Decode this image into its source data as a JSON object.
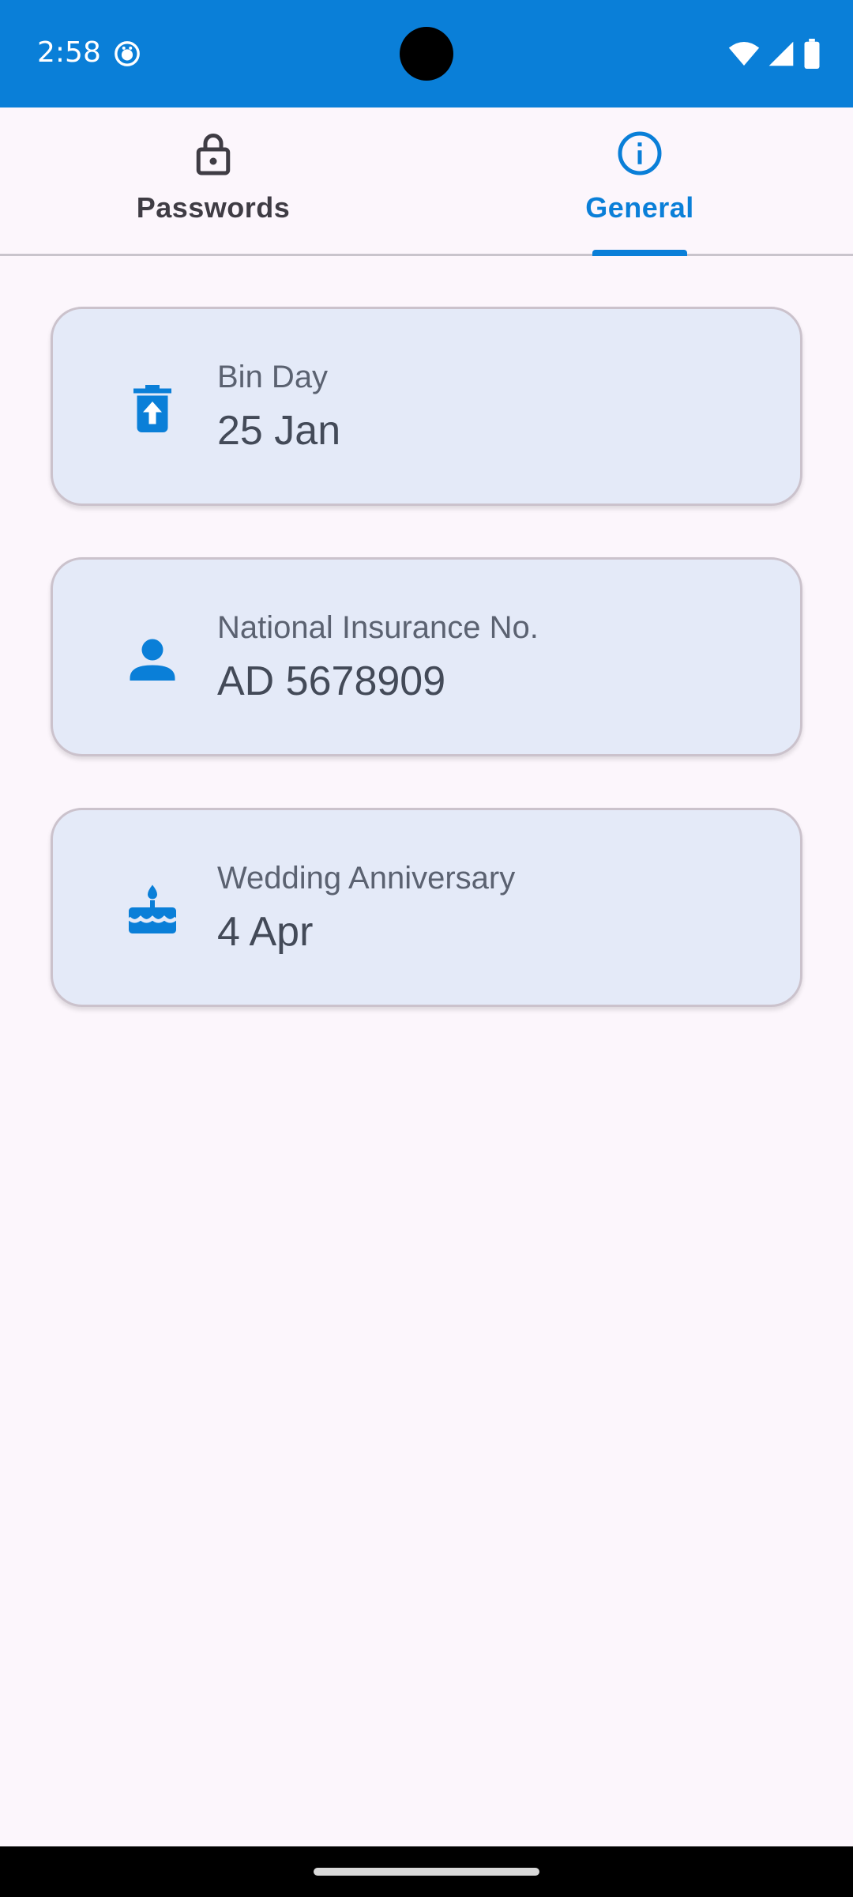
{
  "status_bar": {
    "time": "2:58",
    "background": "#0a7fd8"
  },
  "tabs": [
    {
      "label": "Passwords",
      "icon": "lock-icon",
      "selected": false
    },
    {
      "label": "General",
      "icon": "info-icon",
      "selected": true
    }
  ],
  "accent_color": "#0a7fd8",
  "cards": [
    {
      "label": "Bin Day",
      "value": "25 Jan",
      "icon": "delete-restore-icon"
    },
    {
      "label": "National Insurance No.",
      "value": "AD 5678909",
      "icon": "person-icon"
    },
    {
      "label": "Wedding Anniversary",
      "value": "4 Apr",
      "icon": "cake-icon"
    }
  ]
}
